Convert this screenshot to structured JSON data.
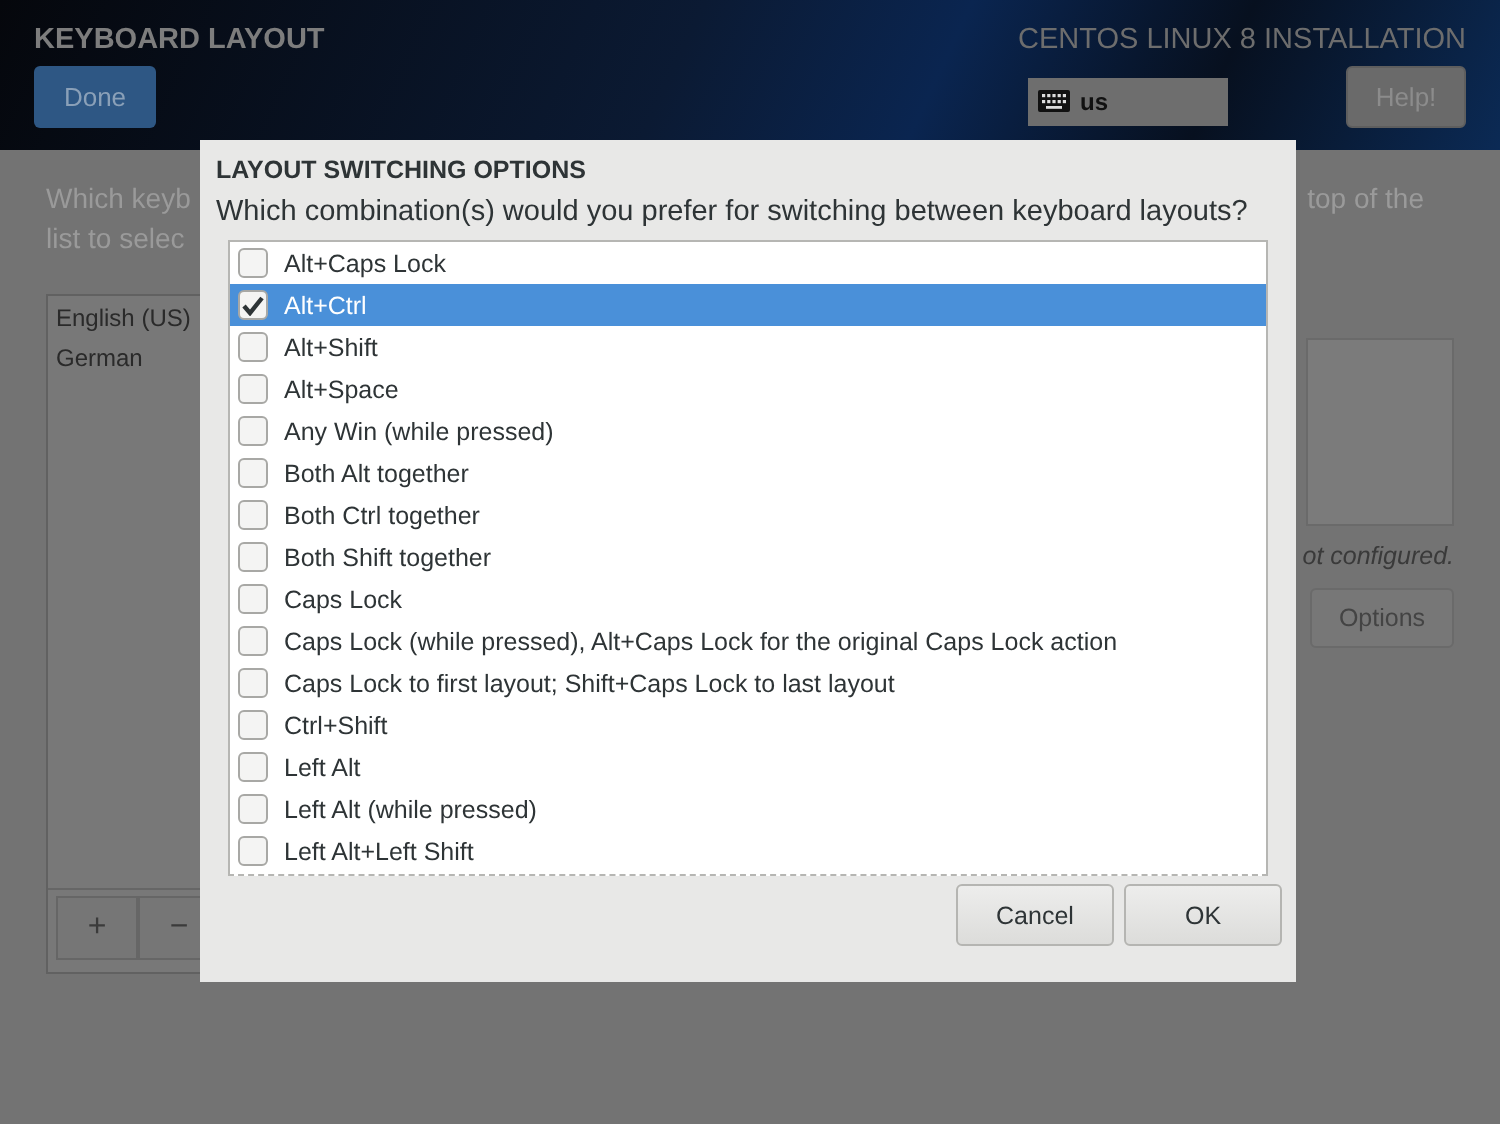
{
  "header": {
    "title": "KEYBOARD LAYOUT",
    "done_button": "Done",
    "product": "CENTOS LINUX 8 INSTALLATION",
    "keyboard_indicator": "us",
    "help_button": "Help!"
  },
  "page": {
    "instructions_left": "Which keyb\nlist to selec",
    "instructions_right": "top of the\n",
    "layouts": [
      {
        "label": "English (US)"
      },
      {
        "label": "German"
      }
    ],
    "toolbar": [
      "+",
      "−"
    ],
    "status": "ot configured.",
    "options_button": "Options"
  },
  "dialog": {
    "title": "LAYOUT SWITCHING OPTIONS",
    "question": "Which combination(s) would you prefer for switching between keyboard layouts?",
    "options": [
      {
        "label": "Alt+Caps Lock",
        "checked": false,
        "selected": false
      },
      {
        "label": "Alt+Ctrl",
        "checked": true,
        "selected": true
      },
      {
        "label": "Alt+Shift",
        "checked": false,
        "selected": false
      },
      {
        "label": "Alt+Space",
        "checked": false,
        "selected": false
      },
      {
        "label": "Any Win (while pressed)",
        "checked": false,
        "selected": false
      },
      {
        "label": "Both Alt together",
        "checked": false,
        "selected": false
      },
      {
        "label": "Both Ctrl together",
        "checked": false,
        "selected": false
      },
      {
        "label": "Both Shift together",
        "checked": false,
        "selected": false
      },
      {
        "label": "Caps Lock",
        "checked": false,
        "selected": false
      },
      {
        "label": "Caps Lock (while pressed), Alt+Caps Lock for the original Caps Lock action",
        "checked": false,
        "selected": false
      },
      {
        "label": "Caps Lock to first layout; Shift+Caps Lock to last layout",
        "checked": false,
        "selected": false
      },
      {
        "label": "Ctrl+Shift",
        "checked": false,
        "selected": false
      },
      {
        "label": "Left Alt",
        "checked": false,
        "selected": false
      },
      {
        "label": "Left Alt (while pressed)",
        "checked": false,
        "selected": false
      },
      {
        "label": "Left Alt+Left Shift",
        "checked": false,
        "selected": false
      }
    ],
    "buttons": [
      "Cancel",
      "OK"
    ]
  }
}
